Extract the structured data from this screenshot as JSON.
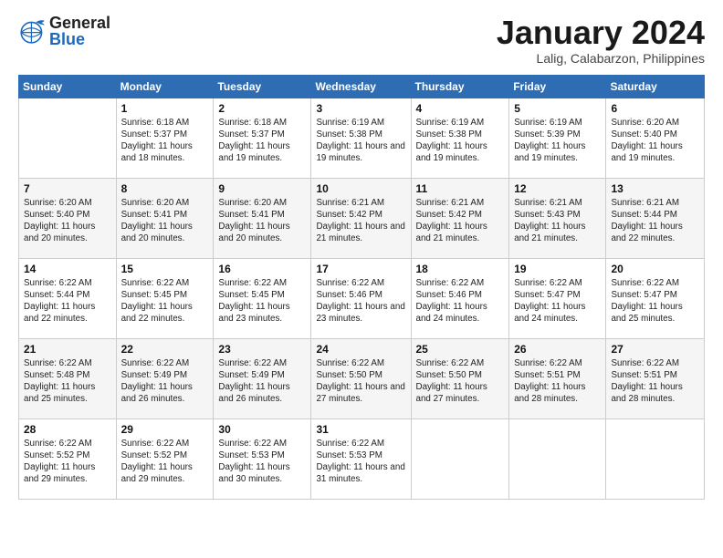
{
  "header": {
    "logo_general": "General",
    "logo_blue": "Blue",
    "month_title": "January 2024",
    "subtitle": "Lalig, Calabarzon, Philippines"
  },
  "weekdays": [
    "Sunday",
    "Monday",
    "Tuesday",
    "Wednesday",
    "Thursday",
    "Friday",
    "Saturday"
  ],
  "weeks": [
    [
      {
        "day": "",
        "sunrise": "",
        "sunset": "",
        "daylight": ""
      },
      {
        "day": "1",
        "sunrise": "Sunrise: 6:18 AM",
        "sunset": "Sunset: 5:37 PM",
        "daylight": "Daylight: 11 hours and 18 minutes."
      },
      {
        "day": "2",
        "sunrise": "Sunrise: 6:18 AM",
        "sunset": "Sunset: 5:37 PM",
        "daylight": "Daylight: 11 hours and 19 minutes."
      },
      {
        "day": "3",
        "sunrise": "Sunrise: 6:19 AM",
        "sunset": "Sunset: 5:38 PM",
        "daylight": "Daylight: 11 hours and 19 minutes."
      },
      {
        "day": "4",
        "sunrise": "Sunrise: 6:19 AM",
        "sunset": "Sunset: 5:38 PM",
        "daylight": "Daylight: 11 hours and 19 minutes."
      },
      {
        "day": "5",
        "sunrise": "Sunrise: 6:19 AM",
        "sunset": "Sunset: 5:39 PM",
        "daylight": "Daylight: 11 hours and 19 minutes."
      },
      {
        "day": "6",
        "sunrise": "Sunrise: 6:20 AM",
        "sunset": "Sunset: 5:40 PM",
        "daylight": "Daylight: 11 hours and 19 minutes."
      }
    ],
    [
      {
        "day": "7",
        "sunrise": "Sunrise: 6:20 AM",
        "sunset": "Sunset: 5:40 PM",
        "daylight": "Daylight: 11 hours and 20 minutes."
      },
      {
        "day": "8",
        "sunrise": "Sunrise: 6:20 AM",
        "sunset": "Sunset: 5:41 PM",
        "daylight": "Daylight: 11 hours and 20 minutes."
      },
      {
        "day": "9",
        "sunrise": "Sunrise: 6:20 AM",
        "sunset": "Sunset: 5:41 PM",
        "daylight": "Daylight: 11 hours and 20 minutes."
      },
      {
        "day": "10",
        "sunrise": "Sunrise: 6:21 AM",
        "sunset": "Sunset: 5:42 PM",
        "daylight": "Daylight: 11 hours and 21 minutes."
      },
      {
        "day": "11",
        "sunrise": "Sunrise: 6:21 AM",
        "sunset": "Sunset: 5:42 PM",
        "daylight": "Daylight: 11 hours and 21 minutes."
      },
      {
        "day": "12",
        "sunrise": "Sunrise: 6:21 AM",
        "sunset": "Sunset: 5:43 PM",
        "daylight": "Daylight: 11 hours and 21 minutes."
      },
      {
        "day": "13",
        "sunrise": "Sunrise: 6:21 AM",
        "sunset": "Sunset: 5:44 PM",
        "daylight": "Daylight: 11 hours and 22 minutes."
      }
    ],
    [
      {
        "day": "14",
        "sunrise": "Sunrise: 6:22 AM",
        "sunset": "Sunset: 5:44 PM",
        "daylight": "Daylight: 11 hours and 22 minutes."
      },
      {
        "day": "15",
        "sunrise": "Sunrise: 6:22 AM",
        "sunset": "Sunset: 5:45 PM",
        "daylight": "Daylight: 11 hours and 22 minutes."
      },
      {
        "day": "16",
        "sunrise": "Sunrise: 6:22 AM",
        "sunset": "Sunset: 5:45 PM",
        "daylight": "Daylight: 11 hours and 23 minutes."
      },
      {
        "day": "17",
        "sunrise": "Sunrise: 6:22 AM",
        "sunset": "Sunset: 5:46 PM",
        "daylight": "Daylight: 11 hours and 23 minutes."
      },
      {
        "day": "18",
        "sunrise": "Sunrise: 6:22 AM",
        "sunset": "Sunset: 5:46 PM",
        "daylight": "Daylight: 11 hours and 24 minutes."
      },
      {
        "day": "19",
        "sunrise": "Sunrise: 6:22 AM",
        "sunset": "Sunset: 5:47 PM",
        "daylight": "Daylight: 11 hours and 24 minutes."
      },
      {
        "day": "20",
        "sunrise": "Sunrise: 6:22 AM",
        "sunset": "Sunset: 5:47 PM",
        "daylight": "Daylight: 11 hours and 25 minutes."
      }
    ],
    [
      {
        "day": "21",
        "sunrise": "Sunrise: 6:22 AM",
        "sunset": "Sunset: 5:48 PM",
        "daylight": "Daylight: 11 hours and 25 minutes."
      },
      {
        "day": "22",
        "sunrise": "Sunrise: 6:22 AM",
        "sunset": "Sunset: 5:49 PM",
        "daylight": "Daylight: 11 hours and 26 minutes."
      },
      {
        "day": "23",
        "sunrise": "Sunrise: 6:22 AM",
        "sunset": "Sunset: 5:49 PM",
        "daylight": "Daylight: 11 hours and 26 minutes."
      },
      {
        "day": "24",
        "sunrise": "Sunrise: 6:22 AM",
        "sunset": "Sunset: 5:50 PM",
        "daylight": "Daylight: 11 hours and 27 minutes."
      },
      {
        "day": "25",
        "sunrise": "Sunrise: 6:22 AM",
        "sunset": "Sunset: 5:50 PM",
        "daylight": "Daylight: 11 hours and 27 minutes."
      },
      {
        "day": "26",
        "sunrise": "Sunrise: 6:22 AM",
        "sunset": "Sunset: 5:51 PM",
        "daylight": "Daylight: 11 hours and 28 minutes."
      },
      {
        "day": "27",
        "sunrise": "Sunrise: 6:22 AM",
        "sunset": "Sunset: 5:51 PM",
        "daylight": "Daylight: 11 hours and 28 minutes."
      }
    ],
    [
      {
        "day": "28",
        "sunrise": "Sunrise: 6:22 AM",
        "sunset": "Sunset: 5:52 PM",
        "daylight": "Daylight: 11 hours and 29 minutes."
      },
      {
        "day": "29",
        "sunrise": "Sunrise: 6:22 AM",
        "sunset": "Sunset: 5:52 PM",
        "daylight": "Daylight: 11 hours and 29 minutes."
      },
      {
        "day": "30",
        "sunrise": "Sunrise: 6:22 AM",
        "sunset": "Sunset: 5:53 PM",
        "daylight": "Daylight: 11 hours and 30 minutes."
      },
      {
        "day": "31",
        "sunrise": "Sunrise: 6:22 AM",
        "sunset": "Sunset: 5:53 PM",
        "daylight": "Daylight: 11 hours and 31 minutes."
      },
      {
        "day": "",
        "sunrise": "",
        "sunset": "",
        "daylight": ""
      },
      {
        "day": "",
        "sunrise": "",
        "sunset": "",
        "daylight": ""
      },
      {
        "day": "",
        "sunrise": "",
        "sunset": "",
        "daylight": ""
      }
    ]
  ]
}
